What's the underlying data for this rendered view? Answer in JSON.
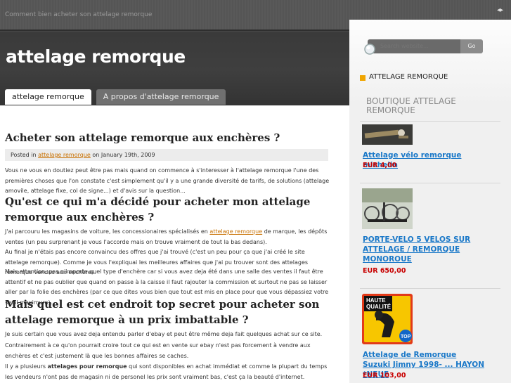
{
  "header": {
    "tagline": "Comment bien acheter son attelage remorque",
    "arrows": "◂▸",
    "site_title": "attelage remorque"
  },
  "nav": {
    "tabs": [
      {
        "label": "attelage remorque",
        "active": true
      },
      {
        "label": "A propos d'attelage remorque",
        "active": false
      }
    ]
  },
  "search": {
    "placeholder": "Search website...",
    "button": "Go"
  },
  "sidebar": {
    "widget_title": "ATTELAGE REMORQUE",
    "boutique": "BOUTIQUE ATTELAGE REMORQUE",
    "products": [
      {
        "name": "Attelage vélo remorque michelin",
        "price": "EUR 4,00"
      },
      {
        "name": "PORTE-VELO 5 VELOS SUR ATTELAGE / REMORQUE MONOROUE",
        "price": "EUR 650,00"
      },
      {
        "name": "Attelage de Remorque Suzuki Jimny 1998- ... HAYON *NEUF",
        "price": "EUR 103,00"
      }
    ],
    "badge_text": [
      "HAUTE",
      "QUALITÉ"
    ],
    "badge_top": "TOP"
  },
  "post": {
    "title": "Acheter son attelage remorque aux enchères ?",
    "meta_prefix": "Posted in",
    "meta_category": "attelage remorque",
    "meta_date": "on January 19th, 2009",
    "intro": "Vous ne vous en doutiez peut être pas mais quand on commence à s'interesser à l'attelage remorque l'une des premières choses que l'on constate c'est simplement qu'il y a une grande diversité de tarifs, de solutions (attelage amovile, attelage fixe, col de signe...) et d'avis sur la question...",
    "h2_1": "Qu'est ce qui m'a décidé pour acheter mon attelage remorque aux enchères ?",
    "p2_before": "J'ai parcouru les magasins de voiture, les concessionaires spécialisés en",
    "p2_link": "attelage remorque",
    "p2_after": "de marque, les dépôts ventes (un peu surprenant je vous l'accorde mais on trouve vraiment de tout la bas dedans).",
    "p3": "Au final je n'étais pas encore convaincu des offres que j'ai trouvé (c'est un peu pour ça que j'ai créé le site attelage remorque). Comme je vous l'expliquai les meilleures affaires que j'ai pu trouver sont des attelages remorque vendus aux enchères.",
    "p4": "Mais attention, pas n'importe quel type d'enchère car si vous avez deja été dans une salle des ventes il faut être attentif et ne pas oublier que quand on passe à la caisse il faut rajouter la commission et surtout ne pas se laisser aller par la folie des enchères (par ce que dites vous bien que tout est mis en place pour que vous dépassiez votre seuil maximum).",
    "h2_2": "Mais quel est cet endroit top secret pour acheter son attelage remorque à un prix imbattable ?",
    "p5": "Je suis certain que vous avez deja entendu parler d'ebay et peut être même deja fait quelques achat sur ce site.",
    "p6": "Contrairement à ce qu'on pourrait croire tout ce qui est en vente sur ebay n'est pas forcement à vendre aux enchères et c'est justement là que les bonnes affaires se caches.",
    "p7_before": "Il y a plusieurs",
    "p7_bold": "attelages pour remorque",
    "p7_after": "qui sont disponibles en achat immédiat et comme la plupart du temps les vendeurs n'ont pas de magasin ni de personel les prix sont vraiment bas, c'est ça la beauté d'internet."
  },
  "colors": {
    "link": "#c87000",
    "product_link": "#1a78c8",
    "price": "#c80000",
    "accent": "#f0a500"
  }
}
